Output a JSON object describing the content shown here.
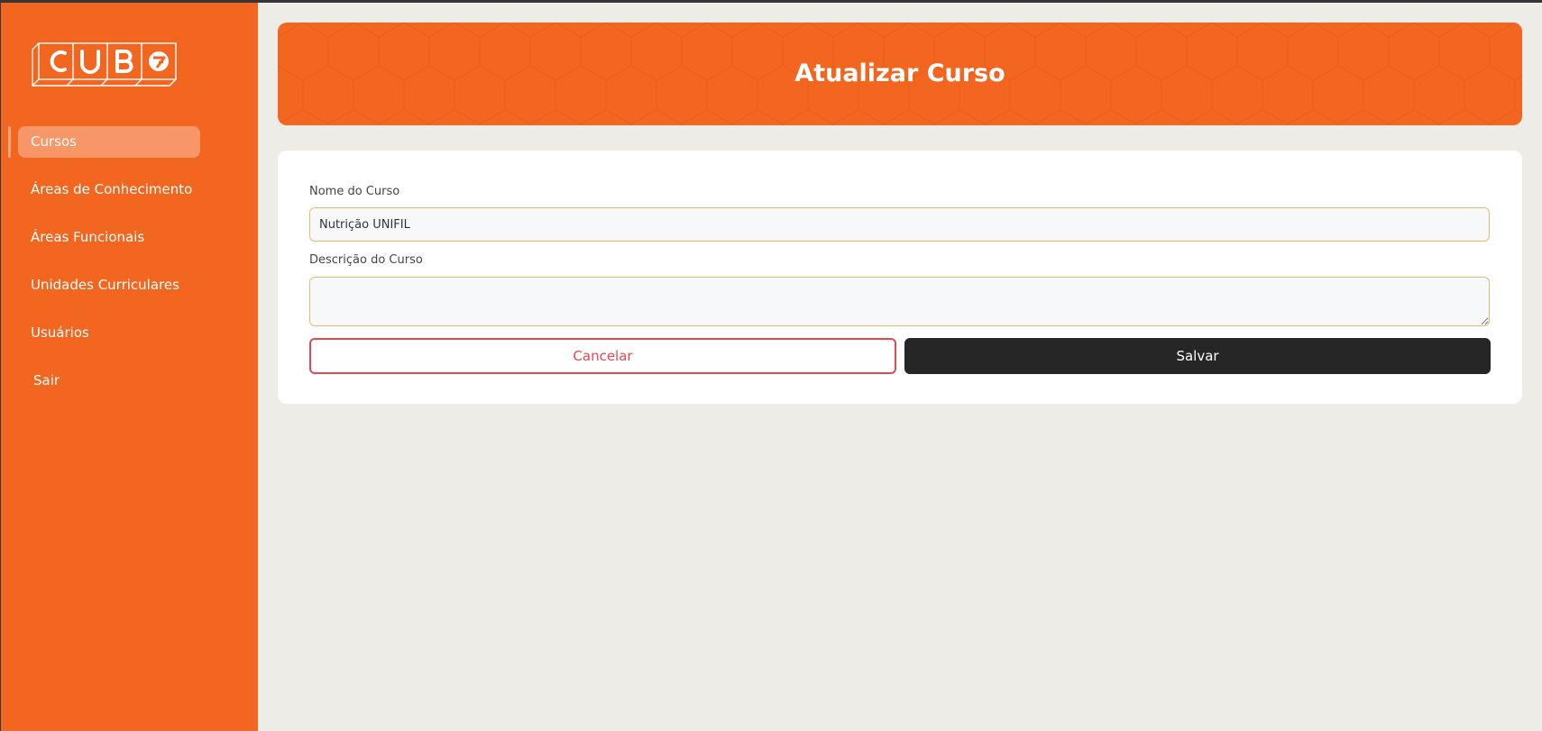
{
  "sidebar": {
    "logo_text": "CUBO",
    "items": [
      {
        "label": "Cursos",
        "active": true
      },
      {
        "label": "Áreas de Conhecimento",
        "active": false
      },
      {
        "label": "Áreas Funcionais",
        "active": false
      },
      {
        "label": "Unidades Curriculares",
        "active": false
      },
      {
        "label": "Usuários",
        "active": false
      },
      {
        "label": "Sair",
        "active": false
      }
    ]
  },
  "header": {
    "title": "Atualizar Curso"
  },
  "form": {
    "name_label": "Nome do Curso",
    "name_value": "Nutrição UNIFIL",
    "description_label": "Descrição do Curso",
    "description_value": "",
    "cancel_label": "Cancelar",
    "save_label": "Salvar"
  },
  "colors": {
    "brand_orange": "#f36620",
    "background": "#eeece7",
    "cancel_red": "#e04852",
    "save_dark": "#262626",
    "input_border": "#e8b96a"
  }
}
